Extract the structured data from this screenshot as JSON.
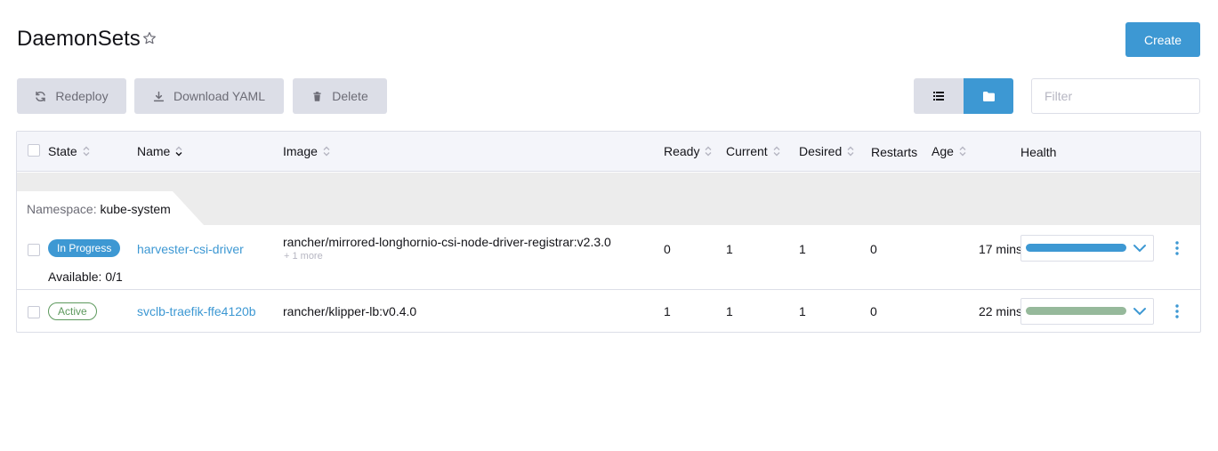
{
  "page": {
    "title": "DaemonSets",
    "create_label": "Create"
  },
  "bulk_actions": {
    "redeploy": "Redeploy",
    "download_yaml": "Download YAML",
    "delete": "Delete"
  },
  "filter": {
    "placeholder": "Filter",
    "value": ""
  },
  "view_toggle": {
    "selected": "folder"
  },
  "columns": {
    "state": "State",
    "name": "Name",
    "image": "Image",
    "ready": "Ready",
    "current": "Current",
    "desired": "Desired",
    "restarts": "Restarts",
    "age": "Age",
    "health": "Health"
  },
  "group": {
    "label": "Namespace:",
    "value": "kube-system"
  },
  "rows": [
    {
      "state": "In Progress",
      "state_detail": "Available: 0/1",
      "name": "harvester-csi-driver",
      "image": "rancher/mirrored-longhornio-csi-node-driver-registrar:v2.3.0",
      "image_more": "+ 1 more",
      "ready": "0",
      "current": "1",
      "desired": "1",
      "restarts": "0",
      "age": "17 mins",
      "health_color": "#3d98d3",
      "health_fraction": 1.0
    },
    {
      "state": "Active",
      "name": "svclb-traefik-ffe4120b",
      "image": "rancher/klipper-lb:v0.4.0",
      "ready": "1",
      "current": "1",
      "desired": "1",
      "restarts": "0",
      "age": "22 mins",
      "health_color": "#96b99b",
      "health_fraction": 1.0
    }
  ],
  "colors": {
    "accent": "#3d98d3",
    "button_gray": "#dcdee7",
    "active_green": "#5d995d"
  }
}
